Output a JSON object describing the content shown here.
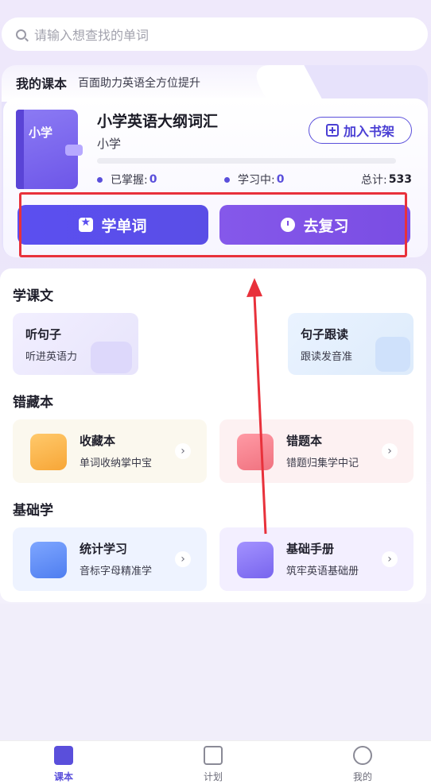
{
  "search": {
    "placeholder": "请输入想查找的单词"
  },
  "course": {
    "header_title": "我的课本",
    "header_subtitle": "百面助力英语全方位提升",
    "book_label": "小学",
    "name": "小学英语大纲词汇",
    "level": "小学",
    "add_shelf_label": "加入书架",
    "progress": 0,
    "stats": {
      "mastered_label": "已掌握:",
      "mastered_value": "0",
      "learning_label": "学习中:",
      "learning_value": "0",
      "total_label": "总计:",
      "total_value": "533"
    },
    "learn_button": "学单词",
    "review_button": "去复习"
  },
  "sections": {
    "text": {
      "title": "学课文",
      "tiles": [
        {
          "title": "听句子",
          "subtitle": "听进英语力"
        },
        {
          "title": "句子跟读",
          "subtitle": "跟读发音准"
        }
      ]
    },
    "mistakes": {
      "title": "错藏本",
      "tiles": [
        {
          "title": "收藏本",
          "subtitle": "单词收纳掌中宝"
        },
        {
          "title": "错题本",
          "subtitle": "错题归集学中记"
        }
      ]
    },
    "basics": {
      "title": "基础学",
      "tiles": [
        {
          "title": "统计学习",
          "subtitle": "音标字母精准学"
        },
        {
          "title": "基础手册",
          "subtitle": "筑牢英语基础册"
        }
      ]
    }
  },
  "tabbar": {
    "items": [
      {
        "label": "课本",
        "icon": "book-icon",
        "active": true
      },
      {
        "label": "计划",
        "icon": "calendar-icon",
        "active": false
      },
      {
        "label": "我的",
        "icon": "profile-icon",
        "active": false
      }
    ]
  },
  "colors": {
    "accent": "#5a4fdb",
    "review": "#7a4de3",
    "highlight": "#e8313b"
  }
}
